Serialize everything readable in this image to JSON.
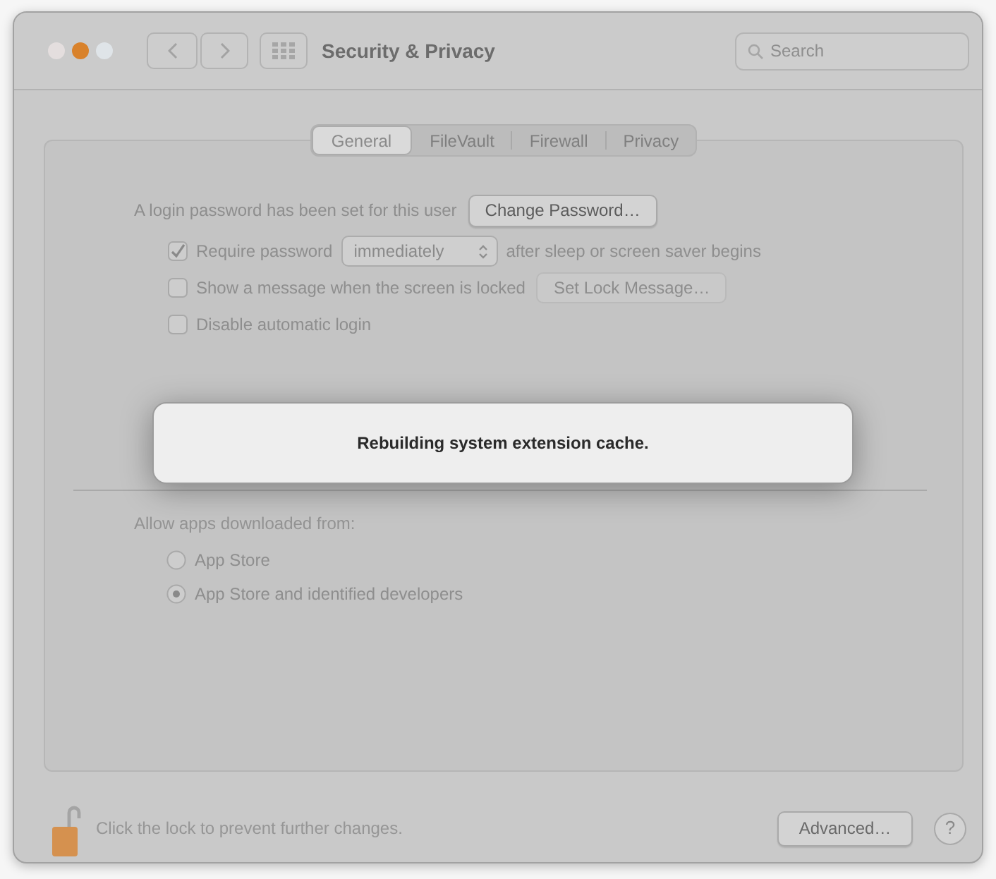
{
  "window": {
    "title": "Security & Privacy"
  },
  "search": {
    "placeholder": "Search"
  },
  "tabs": [
    {
      "label": "General",
      "selected": true
    },
    {
      "label": "FileVault",
      "selected": false
    },
    {
      "label": "Firewall",
      "selected": false
    },
    {
      "label": "Privacy",
      "selected": false
    }
  ],
  "login": {
    "text": "A login password has been set for this user",
    "button": {
      "label": "Change Password…",
      "disabled": false
    }
  },
  "options": [
    {
      "label": "Require password",
      "checked": true,
      "dropdown": {
        "value": "immediately"
      },
      "suffix": "after sleep or screen saver begins"
    },
    {
      "label": "Show a message when the screen is locked",
      "checked": false,
      "button": {
        "label": "Set Lock Message…",
        "disabled": true
      }
    },
    {
      "label": "Disable automatic login",
      "checked": false
    }
  ],
  "downloads": {
    "label": "Allow apps downloaded from:",
    "options": [
      {
        "label": "App Store",
        "selected": false
      },
      {
        "label": "App Store and identified developers",
        "selected": true
      }
    ]
  },
  "dialog": {
    "message": "Rebuilding system extension cache."
  },
  "footer": {
    "lock_text": "Click the lock to prevent further changes.",
    "advanced_button": "Advanced…",
    "help_button": "?"
  }
}
